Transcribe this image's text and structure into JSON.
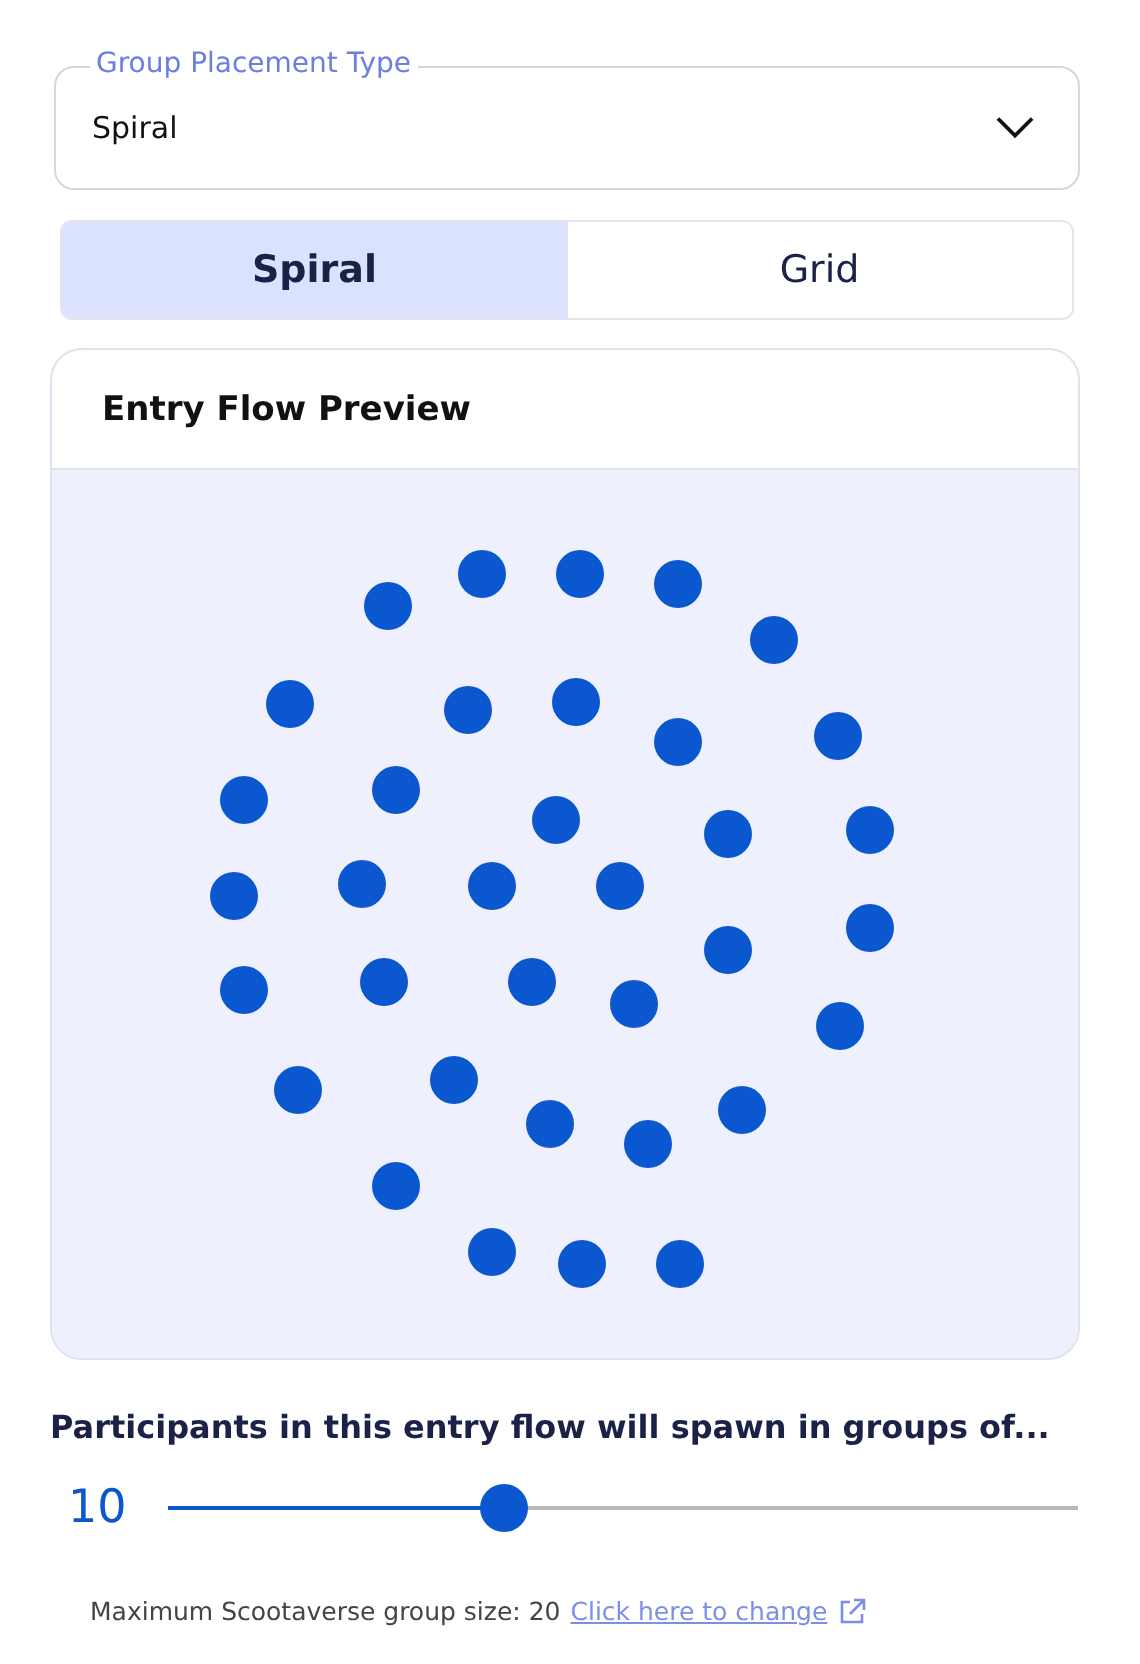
{
  "placement_select": {
    "label": "Group Placement Type",
    "value": "Spiral"
  },
  "tabs": [
    {
      "label": "Spiral",
      "selected": true
    },
    {
      "label": "Grid",
      "selected": false
    }
  ],
  "preview": {
    "title": "Entry Flow Preview",
    "kind": "spiral"
  },
  "group_size": {
    "heading": "Participants in this entry flow will spawn in groups of...",
    "value": "10",
    "level": 0.37
  },
  "footer": {
    "note": "Maximum Scootaverse group size: 20",
    "link": "Click here to change"
  }
}
